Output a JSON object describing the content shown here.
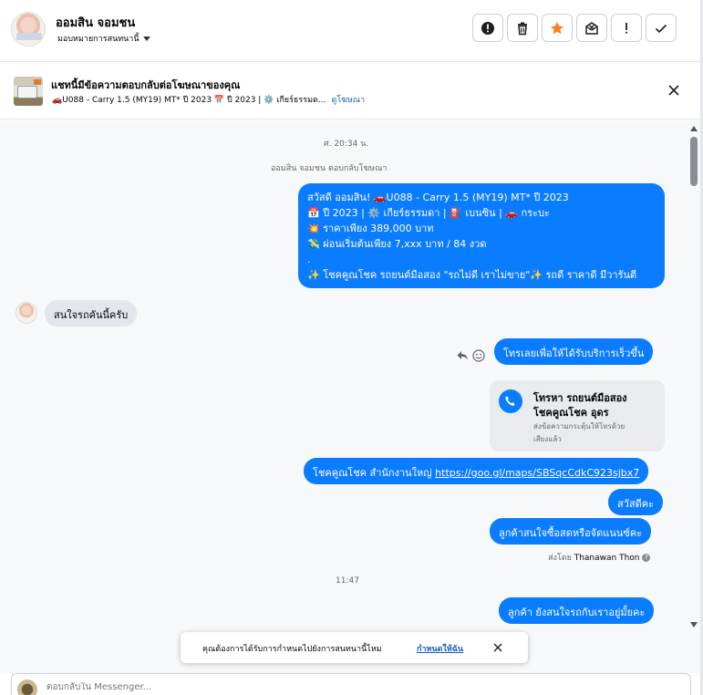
{
  "header": {
    "user_name": "ออมสิน จอมชน",
    "assign_label": "มอบหมายการสนทนานี้",
    "actions": [
      {
        "name": "report",
        "icon": "alert-circle-icon"
      },
      {
        "name": "delete",
        "icon": "trash-icon"
      },
      {
        "name": "star",
        "icon": "star-icon",
        "color": "#f5821f"
      },
      {
        "name": "mark-unread",
        "icon": "envelope-x-icon"
      },
      {
        "name": "spam",
        "icon": "exclamation-icon"
      },
      {
        "name": "done",
        "icon": "check-icon"
      }
    ]
  },
  "ad_banner": {
    "title": "แชทนี้มีข้อความตอบกลับต่อโฆษณาของคุณ",
    "subtitle": "🚗U088 - Carry 1.5 (MY19) MT* ปี 2023 📅 ปี 2023 | ⚙️ เกียร์ธรรมด...",
    "view_ad_link": "ดูโฆษณา"
  },
  "chat": {
    "timestamp_1": "ศ. 20:34 น.",
    "ad_reply_note": "ออมสิน จอมชน ตอบกลับโฆษณา",
    "ad_message_lines": [
      "สวัสดี ออมสิน! 🚗U088 - Carry 1.5 (MY19) MT* ปี 2023",
      "📅 ปี 2023 | ⚙️ เกียร์ธรรมดา | ⛽ เบนซิน | 🚗 กระบะ",
      "💥 ราคาเพียง 389,000 บาท",
      "💸 ผ่อนเริ่มต้นเพียง 7,xxx บาท / 84 งวด",
      ".",
      "✨ โชคคูณโชค รถยนต์มือสอง \"รถไม่ดี เราไม่ขาย\"✨ รถดี ราคาดี มีวารันตี"
    ],
    "incoming_message": "สนใจรถคันนี้ครับ",
    "reply_call": "โทรเลยเพื่อให้ได้รับบริการเร็วขึ้น",
    "call_card": {
      "title_line1": "โทรหา รถยนต์มือสอง",
      "title_line2": "โชคคูณโชค อุดร",
      "desc_line1": "ส่งข้อความกระตุ้นให้โทรด้วย",
      "desc_line2": "เสียงแล้ว"
    },
    "map_message_prefix": "โชคคูณโชค สำนักงานใหญ่",
    "map_link": "https://goo.gl/maps/SBSqcCdkC923sjbx7",
    "greeting": "สวัสดีคะ",
    "question_1": "ลูกค้าสนใจซื้อสดหรือจัดแนนซ์คะ",
    "sent_by_prefix": "ส่งโดย",
    "sent_by_name": "Thanawan Thon",
    "timestamp_2": "11:47",
    "question_2": "ลูกค้า ยังสนใจรถกับเราอยู่มั้ยคะ"
  },
  "toast": {
    "message": "คุณต้องการได้รับการกำหนดไปยังการสนทนานี้ไหม",
    "action": "กำหนดให้ฉัน"
  },
  "composer": {
    "placeholder": "ตอบกลับใน Messenger..."
  },
  "colors": {
    "outgoing_bubble": "#0a7cff",
    "incoming_bubble": "#e4e6eb",
    "link": "#1a5fb4",
    "star": "#f5821f"
  }
}
